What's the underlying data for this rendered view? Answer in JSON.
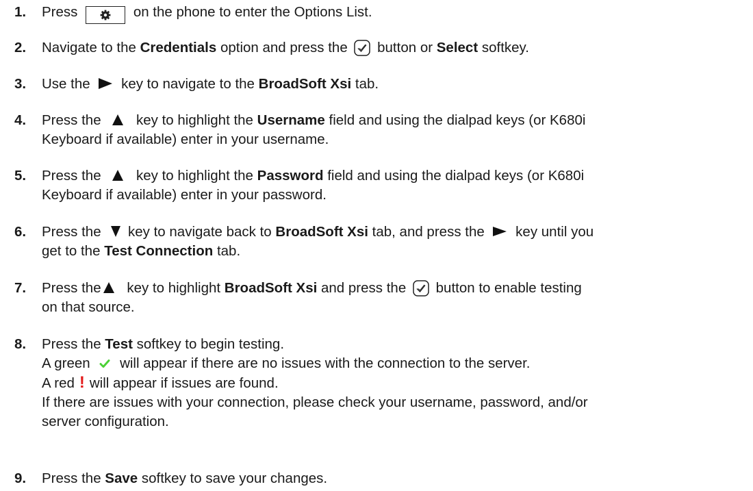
{
  "steps": [
    {
      "number": "1.",
      "lines": [
        [
          "Press",
          "on the phone to enter the Options List."
        ]
      ]
    },
    {
      "number": "2.",
      "parts": [
        "Navigate to the ",
        "Credentials",
        " option and press the",
        "button or ",
        "Select",
        " softkey."
      ]
    },
    {
      "number": "3.",
      "parts": [
        "Use the",
        "key to navigate to the ",
        "BroadSoft Xsi",
        " tab."
      ]
    },
    {
      "number": "4.",
      "parts": [
        "Press the",
        "key to highlight the ",
        "Username",
        " field and using the dialpad keys (or K680i",
        "Keyboard if available) enter in your username."
      ]
    },
    {
      "number": "5.",
      "parts": [
        "Press the",
        "key to highlight the ",
        "Password",
        " field and using the dialpad keys (or K680i",
        "Keyboard if available) enter in your password."
      ]
    },
    {
      "number": "6.",
      "parts": [
        "Press the",
        "key to navigate back to ",
        "BroadSoft Xsi",
        " tab, and press the",
        "key until you",
        "get to the ",
        "Test Connection",
        " tab."
      ]
    },
    {
      "number": "7.",
      "parts": [
        "Press the",
        "key to highlight ",
        "BroadSoft Xsi",
        " and press the",
        "button to enable testing",
        "on that source."
      ]
    },
    {
      "number": "8.",
      "parts": [
        "Press the ",
        "Test",
        " softkey to begin testing.",
        "A green",
        "will appear if there are no issues with the connection to the server.",
        "A red",
        "will appear if issues are found.",
        "If there are issues with your connection, please check your username, password, and/or",
        "server configuration."
      ]
    },
    {
      "number": "9.",
      "parts": [
        "Press the ",
        "Save",
        " softkey to save your changes."
      ]
    }
  ],
  "symbols": {
    "warning_mark": "!"
  },
  "colors": {
    "text": "#1a1a1a",
    "success_check": "#4cd137",
    "warning": "#e31b1b"
  },
  "icons": [
    "gear-icon",
    "checkmark-button-icon",
    "right-arrow-key-icon",
    "up-arrow-key-icon",
    "down-arrow-key-icon",
    "green-checkmark-icon",
    "red-exclamation-icon"
  ]
}
